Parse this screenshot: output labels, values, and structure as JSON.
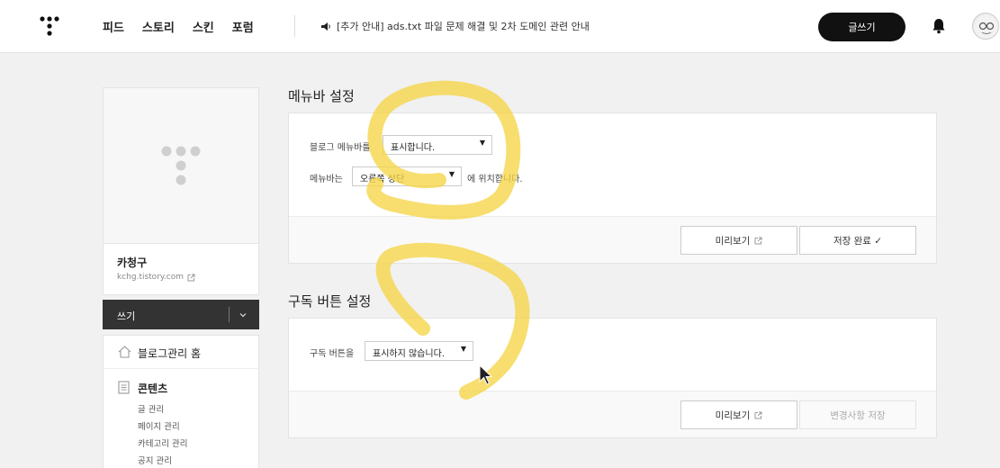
{
  "header": {
    "nav": [
      "피드",
      "스토리",
      "스킨",
      "포럼"
    ],
    "notice": "[추가 안내] ads.txt 파일 문제 해결 및 2차 도메인 관련 안내",
    "write_label": "글쓰기"
  },
  "sidebar": {
    "blog_name": "카청구",
    "blog_url": "kchg.tistory.com",
    "write_label": "쓰기",
    "home_label": "블로그관리 홈",
    "contents_label": "콘텐츠",
    "contents_items": [
      "글 관리",
      "페이지 관리",
      "카테고리 관리",
      "공지 관리"
    ]
  },
  "menubar": {
    "title": "메뉴바 설정",
    "row1_label": "블로그 메뉴바를",
    "row1_value": "표시합니다.",
    "row2_label": "메뉴바는",
    "row2_value": "오른쪽 상단",
    "row2_suffix": "에 위치합니다.",
    "preview_label": "미리보기",
    "save_label": "저장 완료 ✓"
  },
  "subscribe": {
    "title": "구독 버튼 설정",
    "row_label": "구독 버튼을",
    "row_value": "표시하지 않습니다.",
    "preview_label": "미리보기",
    "save_label": "변경사항 저장"
  },
  "colors": {
    "accent": "#111111",
    "scribble": "#f5d547"
  }
}
